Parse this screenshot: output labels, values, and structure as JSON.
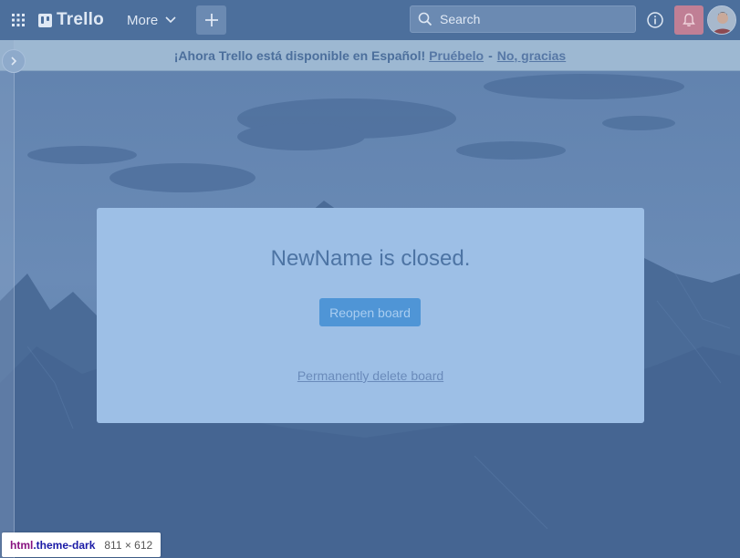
{
  "header": {
    "logo_text": "Trello",
    "more_label": "More",
    "search_placeholder": "Search",
    "icons": [
      "apps-grid-icon",
      "trello-logo-icon",
      "chevron-down-icon",
      "plus-icon",
      "search-icon",
      "info-icon",
      "bell-icon",
      "avatar"
    ]
  },
  "banner": {
    "message": "¡Ahora Trello está disponible en Español!",
    "try_link": "Pruébelo",
    "separator": "-",
    "decline_link": "No, gracias"
  },
  "dialog": {
    "title": "NewName is closed.",
    "reopen_label": "Reopen board",
    "delete_label": "Permanently delete board"
  },
  "devtools_tooltip": {
    "tag": "html",
    "class": ".theme-dark",
    "dimensions": "811 × 612"
  },
  "colors": {
    "header_bg": "#4c6f9c",
    "banner_bg": "#9db8d2",
    "dialog_bg": "#9dbfe6",
    "button_bg": "#4f95d6",
    "notification_bg": "#c07f95"
  }
}
